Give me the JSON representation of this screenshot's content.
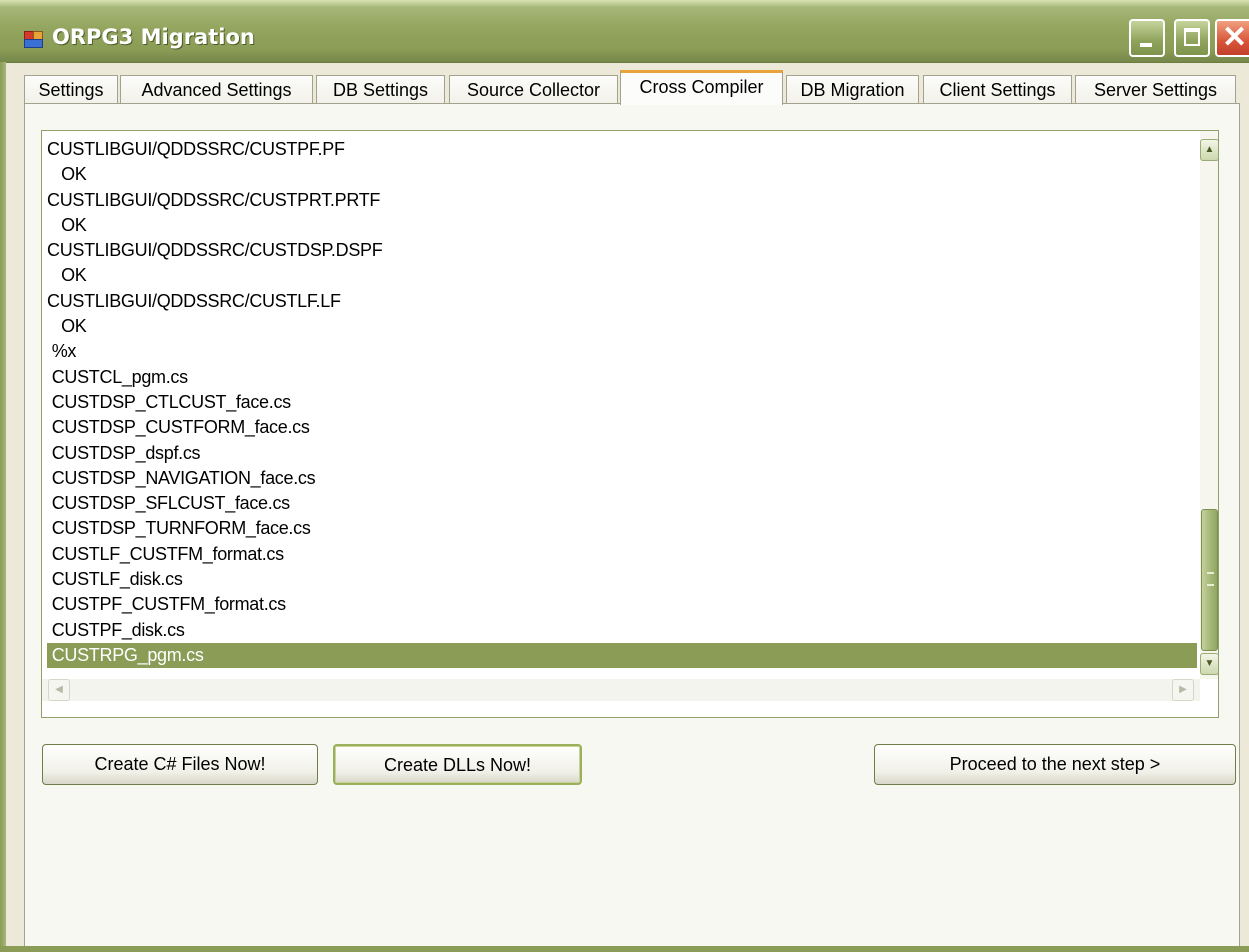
{
  "window": {
    "title": "ORPG3 Migration",
    "theme_accent": "#8a9c55"
  },
  "tabs": [
    {
      "label": "Settings"
    },
    {
      "label": "Advanced Settings"
    },
    {
      "label": "DB Settings"
    },
    {
      "label": "Source Collector"
    },
    {
      "label": "Cross Compiler",
      "active": true
    },
    {
      "label": "DB Migration"
    },
    {
      "label": "Client Settings"
    },
    {
      "label": "Server Settings"
    }
  ],
  "output": {
    "lines": [
      "CUSTLIBGUI/QDDSSRC/CUSTPF.PF",
      "   OK",
      "CUSTLIBGUI/QDDSSRC/CUSTPRT.PRTF",
      "   OK",
      "CUSTLIBGUI/QDDSSRC/CUSTDSP.DSPF",
      "   OK",
      "CUSTLIBGUI/QDDSSRC/CUSTLF.LF",
      "   OK",
      " %x",
      " CUSTCL_pgm.cs",
      " CUSTDSP_CTLCUST_face.cs",
      " CUSTDSP_CUSTFORM_face.cs",
      " CUSTDSP_dspf.cs",
      " CUSTDSP_NAVIGATION_face.cs",
      " CUSTDSP_SFLCUST_face.cs",
      " CUSTDSP_TURNFORM_face.cs",
      " CUSTLF_CUSTFM_format.cs",
      " CUSTLF_disk.cs",
      " CUSTPF_CUSTFM_format.cs",
      " CUSTPF_disk.cs",
      " CUSTRPG_pgm.cs"
    ],
    "selected_index": 20
  },
  "buttons": {
    "create_cs": "Create C# Files Now!",
    "create_dlls": "Create DLLs Now!",
    "proceed": "Proceed to the next step >"
  }
}
